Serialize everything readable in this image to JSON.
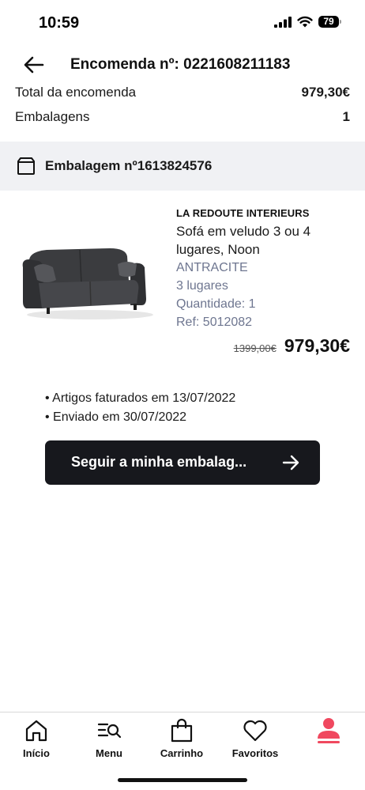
{
  "status_bar": {
    "time": "10:59",
    "battery": "79"
  },
  "header": {
    "title": "Encomenda nº: 0221608211183"
  },
  "summary": {
    "total_label": "Total da encomenda",
    "total_value": "979,30€",
    "packages_label": "Embalagens",
    "packages_value": "1"
  },
  "package": {
    "title": "Embalagem nº1613824576"
  },
  "product": {
    "brand": "LA REDOUTE INTERIEURS",
    "name": "Sofá em veludo 3 ou 4 lugares, Noon",
    "color": "ANTRACITE",
    "size": "3 lugares",
    "quantity": "Quantidade: 1",
    "ref": "Ref: 5012082",
    "old_price": "1399,00€",
    "price": "979,30€"
  },
  "events": [
    "• Artigos faturados em 13/07/2022",
    "• Enviado em 30/07/2022"
  ],
  "track_button": {
    "label": "Seguir a minha embalag..."
  },
  "tabbar": {
    "items": [
      {
        "label": "Início",
        "icon": "home-icon"
      },
      {
        "label": "Menu",
        "icon": "menu-search-icon"
      },
      {
        "label": "Carrinho",
        "icon": "bag-icon"
      },
      {
        "label": "Favoritos",
        "icon": "heart-icon"
      },
      {
        "label": "",
        "icon": "account-icon"
      }
    ],
    "active_color": "#f0485f"
  }
}
